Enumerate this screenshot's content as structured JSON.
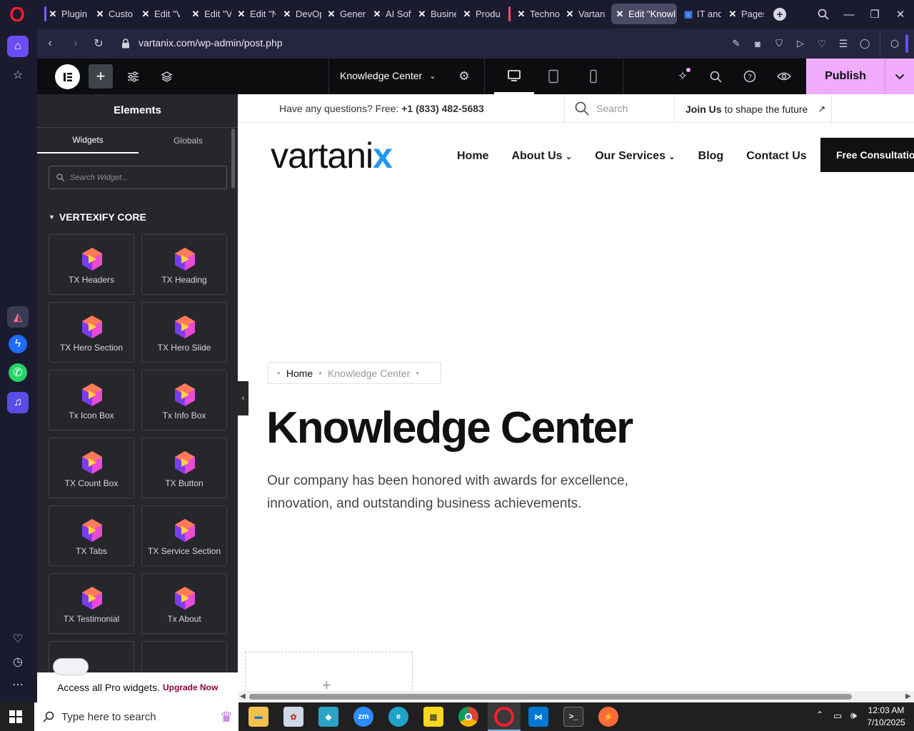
{
  "browser": {
    "tabs": [
      {
        "label": "Plugin"
      },
      {
        "label": "Custo"
      },
      {
        "label": "Edit \"V"
      },
      {
        "label": "Edit \"V"
      },
      {
        "label": "Edit \"N"
      },
      {
        "label": "DevOp"
      },
      {
        "label": "Gener"
      },
      {
        "label": "AI Soft"
      },
      {
        "label": "Busine"
      },
      {
        "label": "Produ"
      },
      {
        "label": "Techno"
      },
      {
        "label": "Vartan"
      },
      {
        "label": "Edit \"Knowl"
      },
      {
        "label": "IT and"
      },
      {
        "label": "Pages"
      }
    ],
    "url": "vartanix.com/wp-admin/post.php"
  },
  "elementor": {
    "document_name": "Knowledge Center",
    "publish_label": "Publish",
    "panel": {
      "title": "Elements",
      "tab_widgets": "Widgets",
      "tab_globals": "Globals",
      "search_placeholder": "Search Widget...",
      "category": "VERTEXIFY CORE",
      "widgets": [
        "TX Headers",
        "TX Heading",
        "TX Hero Section",
        "TX Hero Slide",
        "Tx Icon Box",
        "Tx Info Box",
        "TX Count Box",
        "TX Button",
        "TX Tabs",
        "TX Service Section",
        "TX Testimonial",
        "Tx About"
      ],
      "promo_text": "Access all Pro widgets.",
      "promo_link": "Upgrade Now"
    }
  },
  "site": {
    "topbar": {
      "questions": "Have any questions? Free:",
      "phone_prefix": "+1",
      "phone": "(833) 482-5683",
      "search_placeholder": "Search",
      "join_bold": "Join Us",
      "join_rest": "to shape the future"
    },
    "logo": "vartani",
    "logo_x": "x",
    "nav": {
      "home": "Home",
      "about": "About Us",
      "services": "Our Services",
      "blog": "Blog",
      "contact": "Contact Us",
      "cta": "Free Consultatio"
    },
    "breadcrumb": {
      "home": "Home",
      "current": "Knowledge Center"
    },
    "hero": {
      "title": "Knowledge Center",
      "line1": "Our company has been honored with awards for excellence,",
      "line2": "innovation, and outstanding business achievements."
    }
  },
  "taskbar": {
    "search_placeholder": "Type here to search",
    "time": "12:03 AM",
    "date": "7/10/2025"
  },
  "colors": {
    "publish_bg": "#f0abfc",
    "brand_x": "#2196f3",
    "panel_bg": "#26272b",
    "canvas_bg": "#ffffff"
  }
}
